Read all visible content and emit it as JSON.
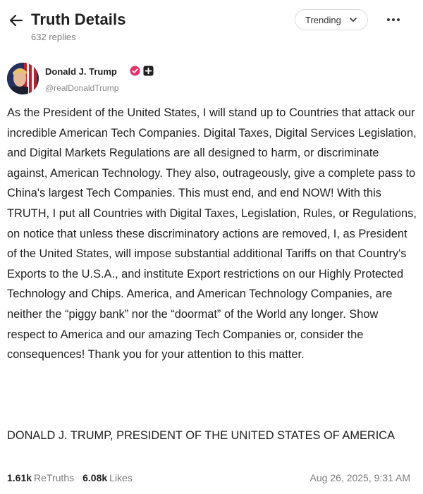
{
  "header": {
    "title": "Truth Details",
    "replies": "632 replies",
    "sort_label": "Trending"
  },
  "author": {
    "name": "Donald J. Trump",
    "handle": "@realDonaldTrump"
  },
  "post": {
    "body": "As the President of the United States, I will stand up to Countries that attack our incredible American Tech Companies. Digital Taxes, Digital Services Legislation, and Digital Markets Regulations are all designed to harm, or discriminate against, American Technology. They also, outrageously, give a complete pass to China's largest Tech Companies. This must end, and end NOW! With this TRUTH, I put all Countries with Digital Taxes, Legislation, Rules, or Regulations, on notice that unless these discriminatory actions are removed, I, as President of the United States, will impose substantial additional Tariffs on that Country's Exports to the U.S.A., and institute Export restrictions on our Highly Protected Technology and Chips. America, and American Technology Companies, are neither the “piggy bank” nor the “doormat” of the World any longer. Show respect to America and our amazing Tech Companies or, consider the consequences! Thank you for your attention to this matter.",
    "signature": "DONALD J. TRUMP, PRESIDENT OF THE UNITED STATES OF AMERICA"
  },
  "stats": {
    "retruths_count": "1.61k",
    "retruths_label": "ReTruths",
    "likes_count": "6.08k",
    "likes_label": "Likes",
    "timestamp": "Aug 26, 2025, 9:31 AM"
  },
  "icons": {
    "back": "arrow-left-icon",
    "sort": "chevron-down-icon",
    "more": "more-horizontal-icon",
    "verified": "verified-badge-icon",
    "badge": "plus-square-icon"
  },
  "colors": {
    "verified": "#e0356b",
    "text": "#1f1f1f",
    "muted": "#7a7a7a"
  }
}
